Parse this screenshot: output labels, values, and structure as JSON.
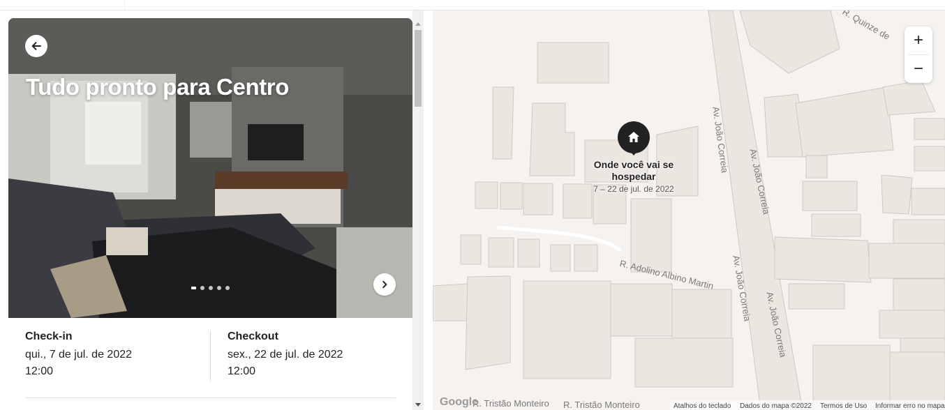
{
  "listing": {
    "title": "Tudo pronto para Centro",
    "photo_count": 5,
    "photo_active_index": 0
  },
  "dates": {
    "checkin_label": "Check-in",
    "checkin_date": "qui., 7 de jul. de 2022",
    "checkin_time": "12:00",
    "checkout_label": "Checkout",
    "checkout_date": "sex., 22 de jul. de 2022",
    "checkout_time": "12:00"
  },
  "map": {
    "pin_label": "Onde você vai se hospedar",
    "pin_dates": "7 – 22 de jul. de 2022",
    "zoom_in": "+",
    "zoom_out": "−",
    "streets": {
      "joao_correia": "Av. João Correia",
      "adolino": "R. Adolino Albino Martin",
      "tristao": "R. Tristão Monteiro",
      "quinze": "R. Quinze de"
    },
    "attribution": {
      "google": "Google",
      "shortcuts": "Atalhos do teclado",
      "map_data": "Dados do mapa ©2022",
      "terms": "Termos de Uso",
      "report": "Informar erro no mapa"
    }
  },
  "icons": {
    "back": "arrow-left-icon",
    "next": "chevron-right-icon",
    "pin": "house-icon"
  }
}
